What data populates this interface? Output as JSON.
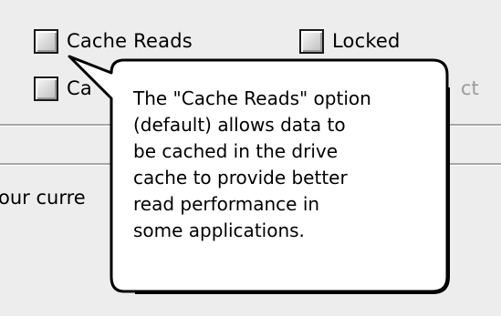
{
  "checkboxes": {
    "cache_reads": {
      "label": "Cache Reads",
      "checked": false
    },
    "locked": {
      "label": "Locked",
      "checked": false
    },
    "cache_writes": {
      "label_visible": "Ca",
      "checked": false
    },
    "protect": {
      "label_visible": "ct"
    }
  },
  "status": {
    "text_visible": "our curre"
  },
  "balloon": {
    "text": "The \"Cache Reads\" option\n(default) allows data to\nbe cached in the drive\ncache to provide better\nread performance in\nsome applications."
  }
}
